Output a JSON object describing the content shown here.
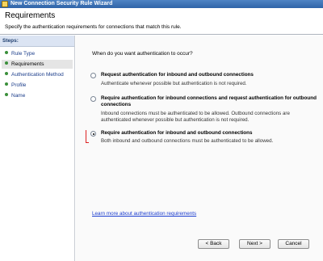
{
  "window": {
    "title": "New Connection Security Rule Wizard"
  },
  "header": {
    "title": "Requirements",
    "description": "Specify the authentication requirements for connections that match this rule."
  },
  "steps": {
    "title": "Steps:",
    "items": [
      {
        "label": "Rule Type"
      },
      {
        "label": "Requirements",
        "active": true
      },
      {
        "label": "Authentication Method"
      },
      {
        "label": "Profile"
      },
      {
        "label": "Name"
      }
    ]
  },
  "main": {
    "question": "When do you want authentication to occur?",
    "options": [
      {
        "label": "Request authentication for inbound and outbound connections",
        "description": "Authenticate whenever possible but authentication is not required.",
        "selected": false
      },
      {
        "label": "Require authentication for inbound connections and request authentication for outbound connections",
        "description": "Inbound connections must be authenticated to be allowed. Outbound connections are authenticated whenever possible but authentication is not required.",
        "selected": false
      },
      {
        "label": "Require authentication for inbound and outbound connections",
        "description": "Both inbound and outbound connections must be authenticated to be allowed.",
        "selected": true
      }
    ],
    "learn_more": "Learn more about authentication requirements"
  },
  "buttons": {
    "back": "< Back",
    "next": "Next >",
    "cancel": "Cancel"
  },
  "colors": {
    "titlebar": "#3a6fb5",
    "link": "#1a3ccf",
    "steps_header": "#dbe4f3",
    "annotation": "#dd2222"
  }
}
